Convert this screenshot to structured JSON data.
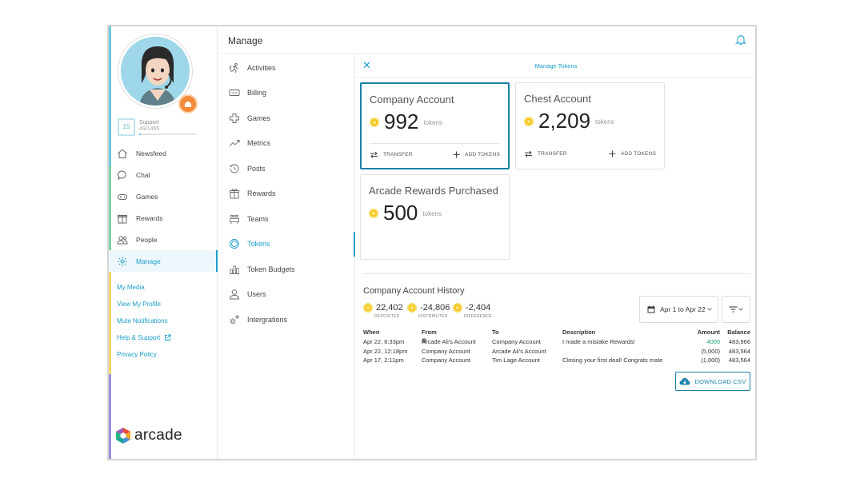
{
  "sidebar": {
    "level": "15",
    "level_title": "Support",
    "level_progress": "49/1465",
    "level_progress_fraction": 0.03,
    "nav": [
      {
        "label": "Newsfeed",
        "icon": "home-icon"
      },
      {
        "label": "Chat",
        "icon": "chat-icon"
      },
      {
        "label": "Games",
        "icon": "gamepad-icon"
      },
      {
        "label": "Rewards",
        "icon": "gift-icon"
      },
      {
        "label": "People",
        "icon": "people-icon"
      },
      {
        "label": "Manage",
        "icon": "gear-icon",
        "active": true
      }
    ],
    "links": [
      "My Media",
      "View My Profile",
      "Mute Notifications",
      "Help & Support",
      "Privacy Policy"
    ],
    "logo_text": "arcade"
  },
  "topbar": {
    "title": "Manage"
  },
  "menu": [
    {
      "label": "Activities",
      "icon": "running-icon"
    },
    {
      "label": "Billing",
      "icon": "visa-card-icon"
    },
    {
      "label": "Games",
      "icon": "puzzle-icon"
    },
    {
      "label": "Metrics",
      "icon": "trend-icon"
    },
    {
      "label": "Posts",
      "icon": "history-icon"
    },
    {
      "label": "Rewards",
      "icon": "gift-icon"
    },
    {
      "label": "Teams",
      "icon": "team-icon"
    },
    {
      "label": "Tokens",
      "icon": "token-icon",
      "active": true
    },
    {
      "label": "Token Budgets",
      "icon": "bar-chart-icon"
    },
    {
      "label": "Users",
      "icon": "user-icon"
    },
    {
      "label": "Intergrations",
      "icon": "gears-icon"
    }
  ],
  "panel": {
    "title": "Manage Tokens",
    "cards": [
      {
        "name": "Company Account",
        "amount": "992",
        "unit": "tokens",
        "transfer": "TRANSFER",
        "add": "ADD TOKENS"
      },
      {
        "name": "Chest Account",
        "amount": "2,209",
        "unit": "tokens",
        "transfer": "TRANSFER",
        "add": "ADD TOKENS"
      },
      {
        "name": "Arcade Rewards Purchased",
        "amount": "500",
        "unit": "tokens"
      }
    ],
    "history": {
      "title": "Company Account History",
      "stats": [
        {
          "value": "22,402",
          "label": "DEPOSITED"
        },
        {
          "value": "-24,806",
          "label": "DISTRIBUTED"
        },
        {
          "value": "-2,404",
          "label": "DIFFERENCE"
        }
      ],
      "date_range": "Apr 1 to Apr 22",
      "columns": [
        "When",
        "From",
        "To",
        "Description",
        "Amount",
        "Balance"
      ],
      "rows": [
        {
          "when": "Apr 22, 6:33pm",
          "from": "Arcade Ali's Account",
          "to": "Company Account",
          "description": "I made a mistake Rewards!",
          "amount": "4000",
          "balance": "483,966"
        },
        {
          "when": "Apr 22, 12:18pm",
          "from": "Company Account",
          "to": "Arcade Ali's Account",
          "description": "",
          "amount": "(5,000)",
          "balance": "483,564"
        },
        {
          "when": "Apr 17, 2:11pm",
          "from": "Company Account",
          "to": "Tim Lage Account",
          "description": "Closing your first deal! Congrats mate",
          "amount": "(1,000)",
          "balance": "483,564"
        }
      ],
      "download": "DOWNLOAD CSV"
    }
  },
  "colors": {
    "accent": "#1a9dc9",
    "selected_border": "#1a82a8",
    "coin": "#f5c518",
    "positive": "#1a9d7a"
  }
}
